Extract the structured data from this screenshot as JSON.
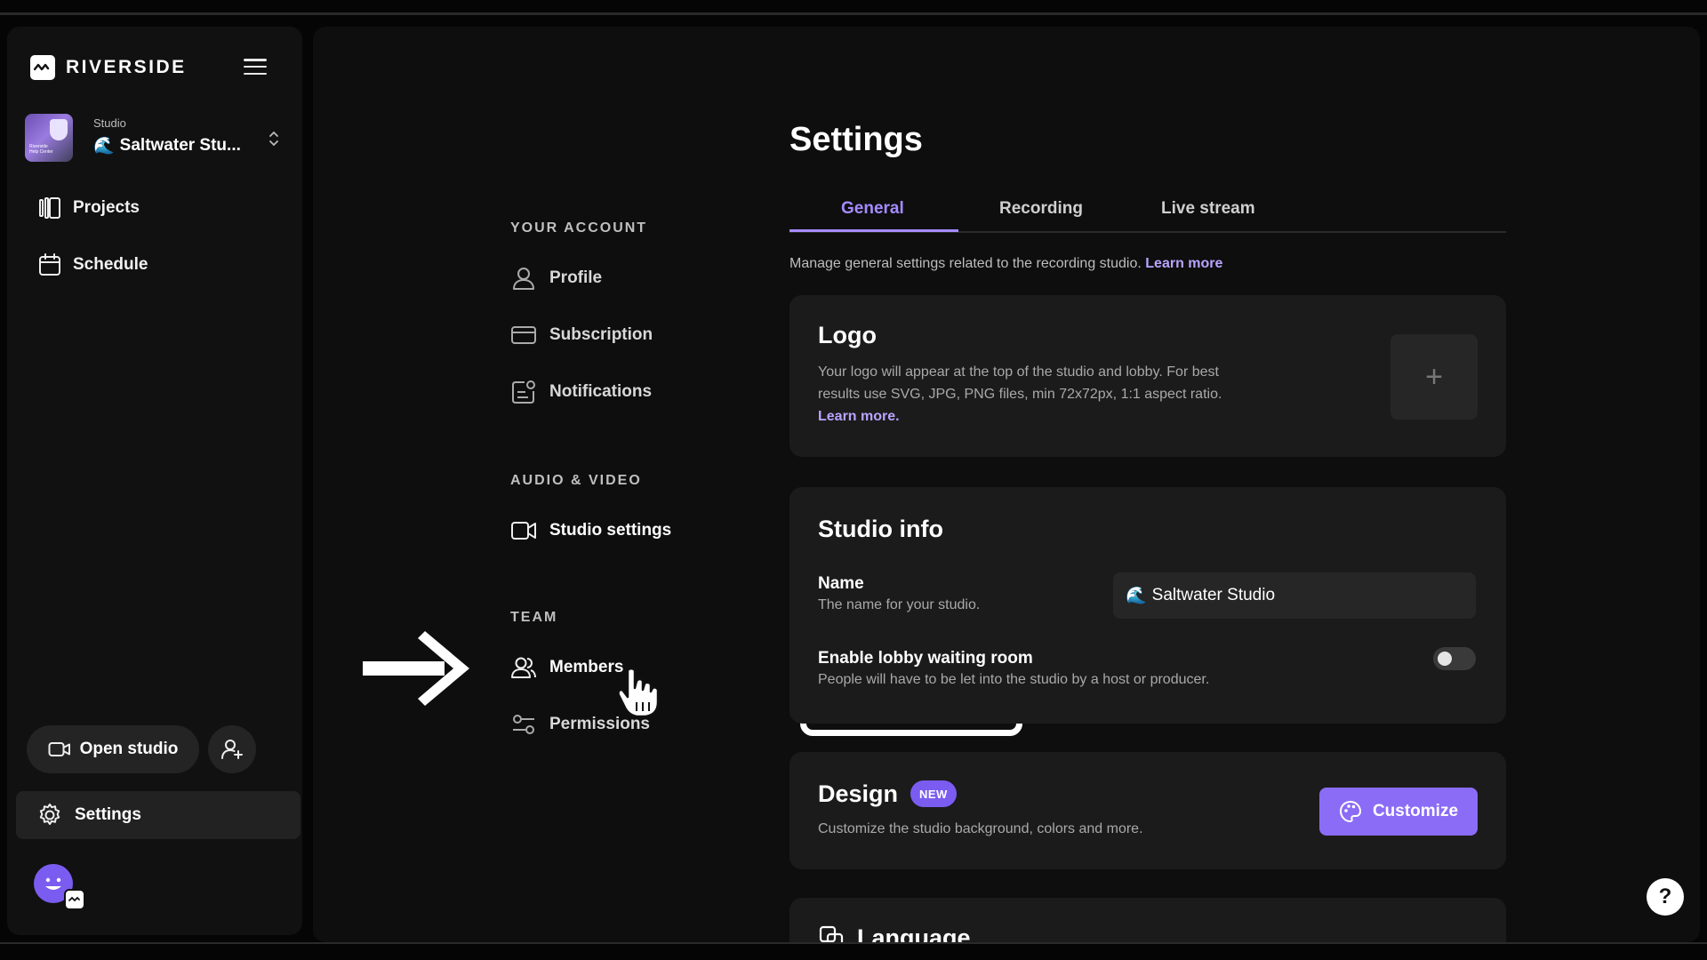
{
  "brand": {
    "name": "RIVERSIDE"
  },
  "studio": {
    "kicker": "Studio",
    "emoji": "🌊",
    "name": "Saltwater Stu..."
  },
  "sidebar": {
    "items": [
      {
        "label": "Projects",
        "icon": "projects-icon"
      },
      {
        "label": "Schedule",
        "icon": "calendar-icon"
      }
    ],
    "open_studio_label": "Open studio",
    "settings_label": "Settings"
  },
  "settings": {
    "title": "Settings",
    "tabs": [
      {
        "label": "General",
        "active": true
      },
      {
        "label": "Recording",
        "active": false
      },
      {
        "label": "Live stream",
        "active": false
      }
    ],
    "description": "Manage general settings related to the recording studio.",
    "description_link": "Learn more"
  },
  "menu": {
    "your_account": {
      "title": "YOUR ACCOUNT",
      "items": [
        "Profile",
        "Subscription",
        "Notifications"
      ]
    },
    "audio_video": {
      "title": "AUDIO & VIDEO",
      "items": [
        "Studio settings"
      ]
    },
    "team": {
      "title": "TEAM",
      "items": [
        "Members",
        "Permissions"
      ]
    }
  },
  "logo_card": {
    "title": "Logo",
    "line1": "Your logo will appear at the top of the studio and lobby. For best",
    "line2": "results use SVG, JPG, PNG files, min 72x72px, 1:1 aspect ratio.",
    "link": "Learn more.",
    "upload_symbol": "+"
  },
  "studio_info_card": {
    "title": "Studio info",
    "name_label": "Name",
    "name_help": "The name for your studio.",
    "name_emoji": "🌊",
    "name_value": "Saltwater Studio",
    "lobby_label": "Enable lobby waiting room",
    "lobby_help": "People will have to be let into the studio by a host or producer.",
    "lobby_enabled": false
  },
  "design_card": {
    "title": "Design",
    "badge": "NEW",
    "text": "Customize the studio background, colors and more.",
    "button": "Customize"
  },
  "language_card": {
    "title": "Language"
  },
  "help": {
    "symbol": "?"
  },
  "colors": {
    "accent": "#8b6cf6",
    "accent_text": "#a58bff",
    "link": "#b8a4ff",
    "card_bg": "#1b1b1b"
  }
}
